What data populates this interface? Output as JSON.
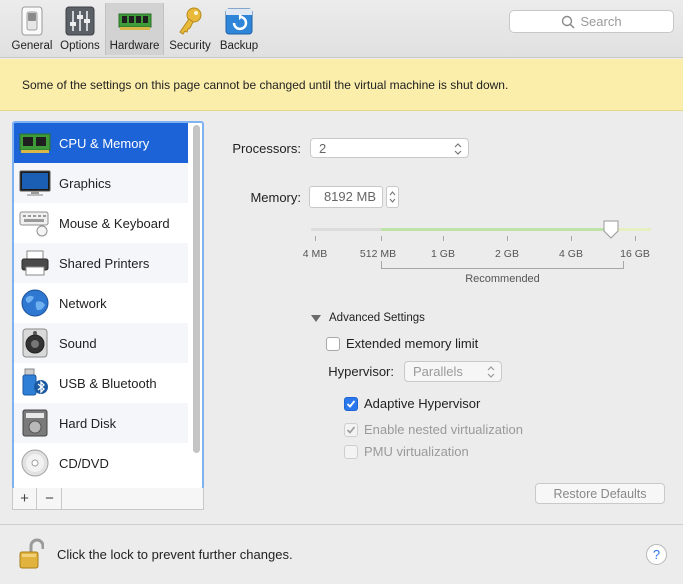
{
  "toolbar": {
    "tabs": [
      {
        "label": "General",
        "icon": "general-switch-icon"
      },
      {
        "label": "Options",
        "icon": "options-sliders-icon"
      },
      {
        "label": "Hardware",
        "icon": "hardware-chip-icon",
        "selected": true
      },
      {
        "label": "Security",
        "icon": "key-icon"
      },
      {
        "label": "Backup",
        "icon": "backup-icon"
      }
    ],
    "search_placeholder": "Search"
  },
  "banner": {
    "text": "Some of the settings on this page cannot be changed until the virtual machine is shut down."
  },
  "sidebar": {
    "items": [
      {
        "label": "CPU & Memory",
        "icon": "cpu-memory-icon",
        "selected": true
      },
      {
        "label": "Graphics",
        "icon": "monitor-icon"
      },
      {
        "label": "Mouse & Keyboard",
        "icon": "keyboard-mouse-icon"
      },
      {
        "label": "Shared Printers",
        "icon": "printer-icon"
      },
      {
        "label": "Network",
        "icon": "globe-icon"
      },
      {
        "label": "Sound",
        "icon": "speaker-icon"
      },
      {
        "label": "USB & Bluetooth",
        "icon": "usb-bluetooth-icon"
      },
      {
        "label": "Hard Disk",
        "icon": "hard-disk-icon"
      },
      {
        "label": "CD/DVD",
        "icon": "cd-dvd-icon"
      }
    ],
    "add_label": "+",
    "remove_label": "−"
  },
  "cpu": {
    "processors_label": "Processors:",
    "processors_value": "2",
    "memory_label": "Memory:",
    "memory_value": "8192 MB",
    "slider": {
      "ticks": [
        "4 MB",
        "512 MB",
        "1 GB",
        "2 GB",
        "4 GB",
        "16 GB"
      ],
      "recommended_label": "Recommended",
      "value": "8192 MB"
    }
  },
  "advanced": {
    "header": "Advanced Settings",
    "extended_memory_label": "Extended memory limit",
    "extended_memory_checked": false,
    "hypervisor_label": "Hypervisor:",
    "hypervisor_value": "Parallels",
    "adaptive_label": "Adaptive Hypervisor",
    "adaptive_checked": true,
    "nested_label": "Enable nested virtualization",
    "nested_checked": true,
    "pmu_label": "PMU virtualization",
    "pmu_checked": false,
    "restore_label": "Restore Defaults"
  },
  "footer": {
    "lock_text": "Click the lock to prevent further changes.",
    "help_label": "?"
  },
  "colors": {
    "selection": "#1d63d8",
    "banner": "#fbeeab",
    "checkbox_on": "#2a78ec",
    "focus_ring": "#7fb2f0"
  }
}
